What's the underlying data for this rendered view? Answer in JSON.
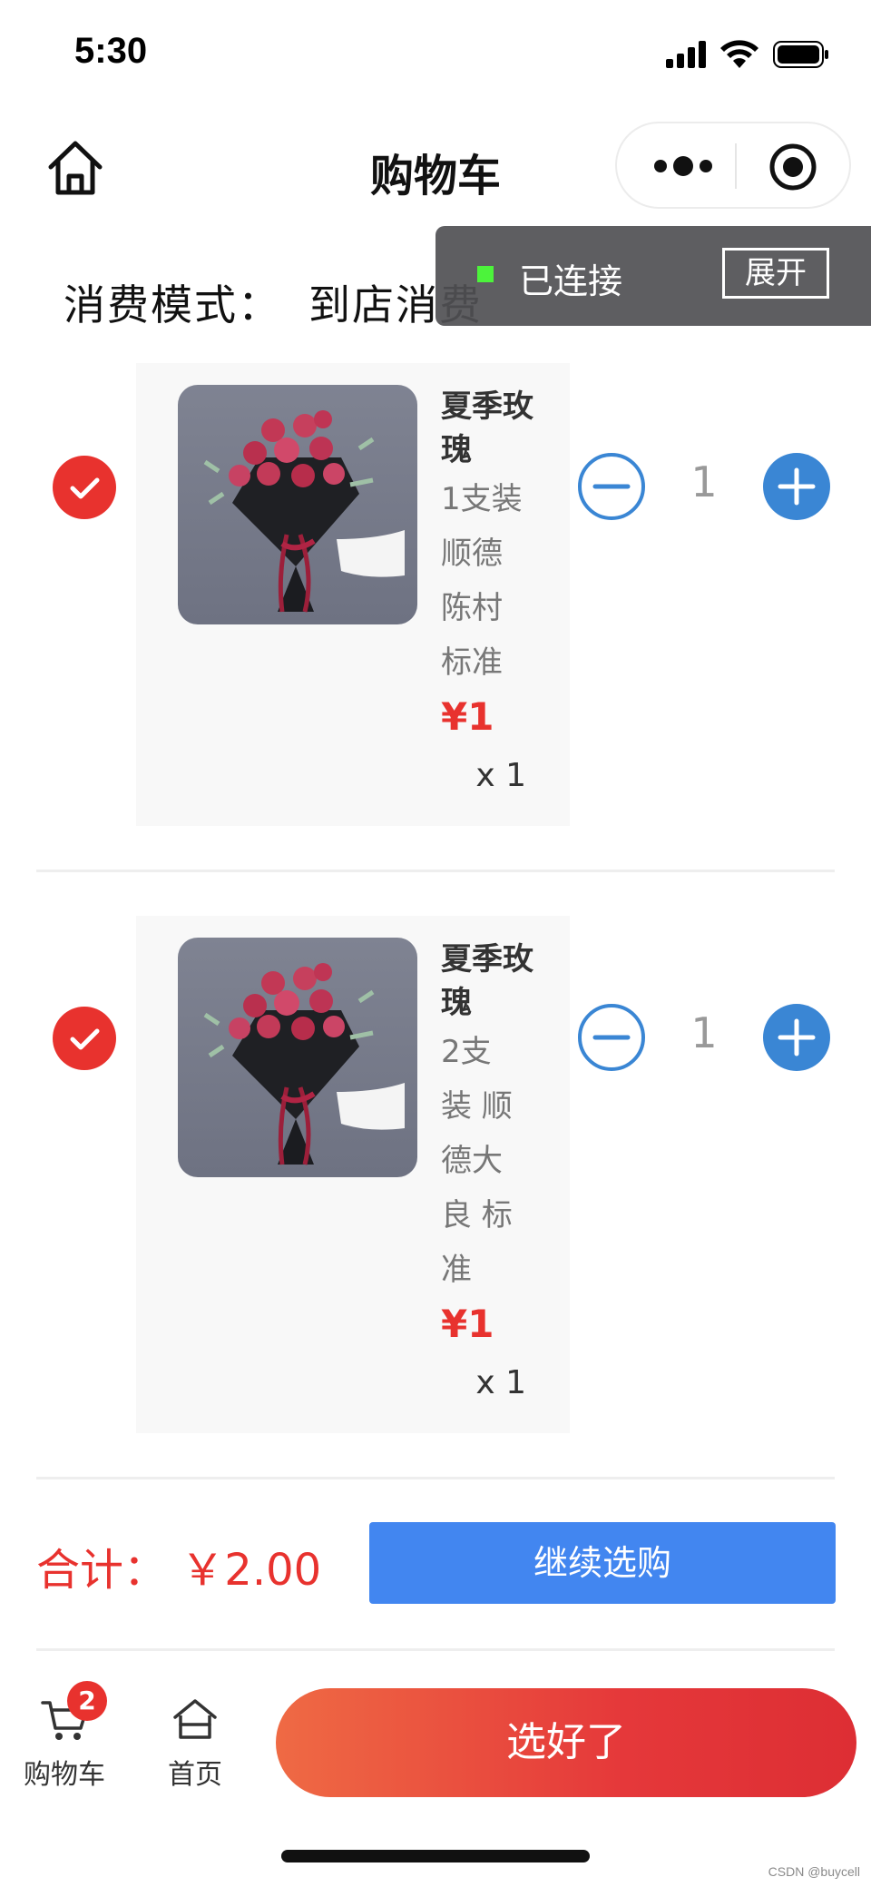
{
  "status_bar": {
    "time": "5:30"
  },
  "nav": {
    "title": "购物车"
  },
  "debug_overlay": {
    "status": "已连接",
    "button": "展开"
  },
  "mode": {
    "label": "消费模式：",
    "value": "到店消费"
  },
  "items": [
    {
      "name": "夏季玫瑰",
      "spec_lines": [
        "1支装",
        "顺德",
        "陈村",
        "标准"
      ],
      "price": "¥1",
      "qty_label": "x 1",
      "stepper_qty": "1",
      "checked": true
    },
    {
      "name": "夏季玫瑰",
      "spec_lines": [
        "2支",
        "装 顺",
        "德大",
        "良 标",
        "准"
      ],
      "price": "¥1",
      "qty_label": "x 1",
      "stepper_qty": "1",
      "checked": true
    }
  ],
  "total": {
    "label": "合计：",
    "amount": "￥2.00"
  },
  "buttons": {
    "continue": "继续选购",
    "done": "选好了"
  },
  "tabbar": {
    "cart_label": "购物车",
    "cart_badge": "2",
    "home_label": "首页"
  },
  "watermark": "CSDN @buycell",
  "colors": {
    "accent_red": "#e8322e",
    "accent_blue": "#4286f0",
    "stepper_blue": "#3a86d4",
    "debug_green": "#4cf33b"
  }
}
